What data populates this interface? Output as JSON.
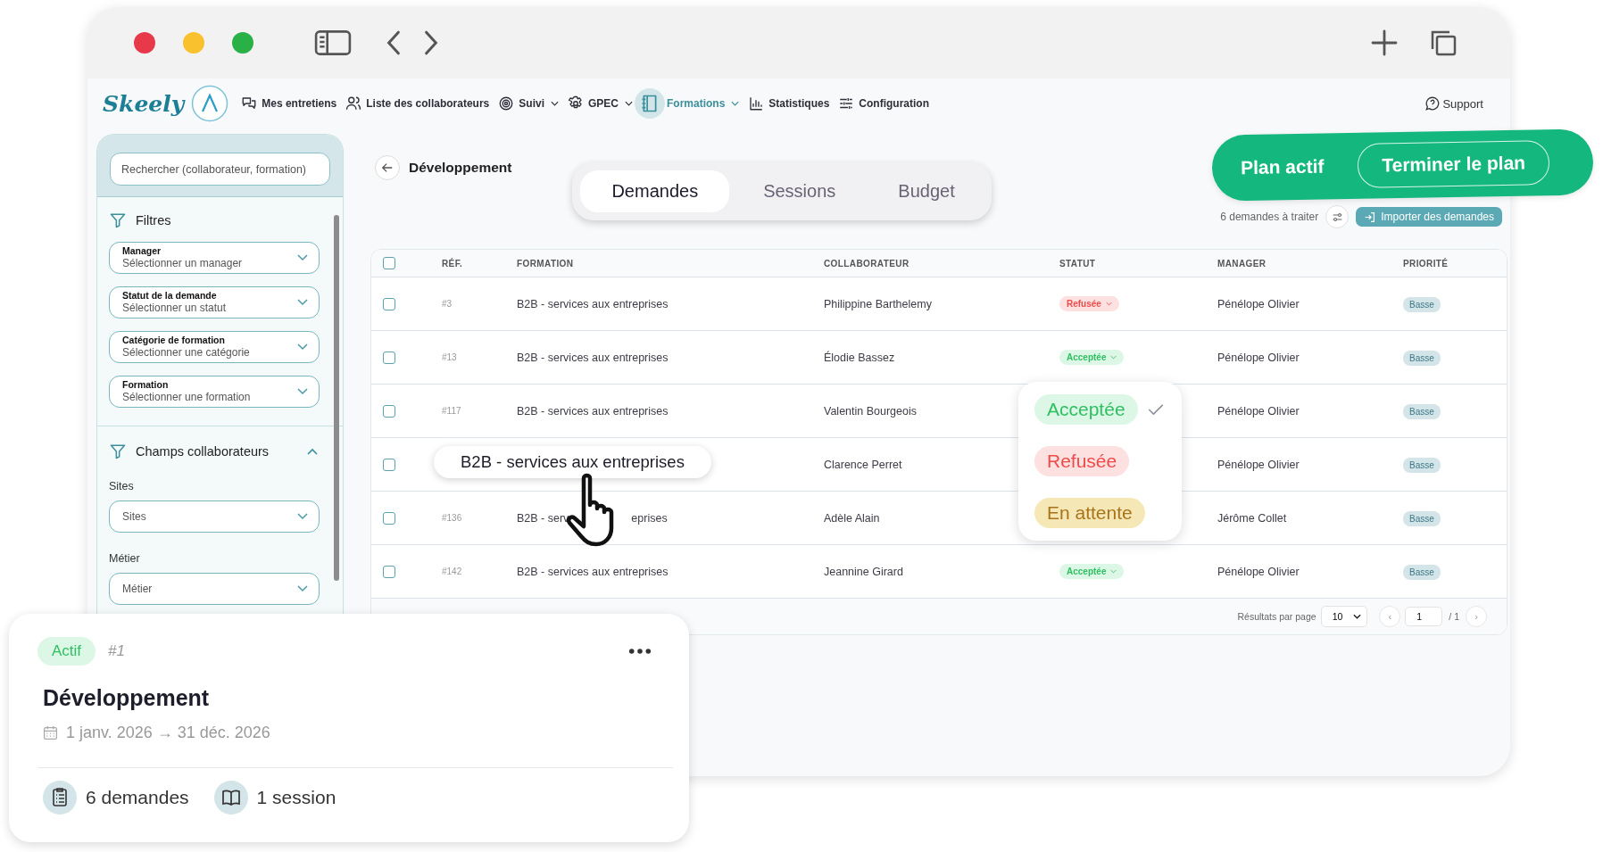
{
  "nav": {
    "logo": "Skeely",
    "items": [
      {
        "label": "Mes entretiens",
        "selected": false,
        "dropdown": false
      },
      {
        "label": "Liste des collaborateurs",
        "selected": false,
        "dropdown": false
      },
      {
        "label": "Suivi",
        "selected": false,
        "dropdown": true
      },
      {
        "label": "GPEC",
        "selected": false,
        "dropdown": true
      },
      {
        "label": "Formations",
        "selected": true,
        "dropdown": true
      },
      {
        "label": "Statistiques",
        "selected": false,
        "dropdown": false
      },
      {
        "label": "Configuration",
        "selected": false,
        "dropdown": false
      }
    ],
    "support": "Support"
  },
  "sidebar": {
    "search": {
      "placeholder": "Rechercher (collaborateur, formation)"
    },
    "filters_title": "Filtres",
    "filters": [
      {
        "label": "Manager",
        "placeholder": "Sélectionner un manager"
      },
      {
        "label": "Statut de la demande",
        "placeholder": "Sélectionner un statut"
      },
      {
        "label": "Catégorie de formation",
        "placeholder": "Sélectionner une catégorie"
      },
      {
        "label": "Formation",
        "placeholder": "Sélectionner une formation"
      }
    ],
    "section": {
      "title": "Champs collaborateurs",
      "expanded": true,
      "fields": [
        {
          "label": "Sites",
          "placeholder": "Sites"
        },
        {
          "label": "Métier",
          "placeholder": "Métier"
        }
      ]
    }
  },
  "header": {
    "title": "Développement",
    "tabs": [
      {
        "label": "Demandes",
        "selected": true
      },
      {
        "label": "Sessions",
        "selected": false
      },
      {
        "label": "Budget",
        "selected": false
      }
    ],
    "pending": "6 demandes à traiter",
    "import_button": "Importer des demandes"
  },
  "plan_banner": {
    "label": "Plan actif",
    "button": "Terminer le plan"
  },
  "table": {
    "select_all_checked": false,
    "columns": [
      "RÉF.",
      "FORMATION",
      "COLLABORATEUR",
      "STATUT",
      "MANAGER",
      "PRIORITÉ"
    ],
    "rows": [
      {
        "checked": false,
        "ref": "#3",
        "formation": "B2B - services aux entreprises",
        "collaborateur": "Philippine Barthelemy",
        "statut": {
          "label": "Refusée",
          "kind": "refused"
        },
        "manager": "Pénélope Olivier",
        "priorite": "Basse"
      },
      {
        "checked": false,
        "ref": "#13",
        "formation": "B2B - services aux entreprises",
        "collaborateur": "Élodie Bassez",
        "statut": {
          "label": "Acceptée",
          "kind": "accepted"
        },
        "manager": "Pénélope Olivier",
        "priorite": "Basse"
      },
      {
        "checked": false,
        "ref": "#117",
        "formation": "B2B - services aux entreprises",
        "collaborateur": "Valentin Bourgeois",
        "manager": "Pénélope Olivier",
        "priorite": "Basse"
      },
      {
        "checked": false,
        "collaborateur": "Clarence Perret",
        "manager": "Pénélope Olivier",
        "priorite": "Basse"
      },
      {
        "checked": false,
        "ref": "#136",
        "formation_parts": [
          "B2B - serv",
          "eprises"
        ],
        "collaborateur": "Adèle Alain",
        "manager": "Jérôme Collet",
        "priorite": "Basse"
      },
      {
        "checked": false,
        "ref": "#142",
        "formation": "B2B - services aux entreprises",
        "collaborateur": "Jeannine Girard",
        "statut": {
          "label": "Acceptée",
          "kind": "accepted"
        },
        "manager": "Pénélope Olivier",
        "priorite": "Basse"
      }
    ],
    "footer": {
      "per_page_label": "Résultats par page",
      "per_page": "10",
      "prev": "‹",
      "page": "1",
      "total": "/ 1",
      "next": "›"
    }
  },
  "tooltip": {
    "text": "B2B - services aux entreprises"
  },
  "status_menu": {
    "options": [
      {
        "label": "Acceptée",
        "kind": "accepted",
        "selected": true
      },
      {
        "label": "Refusée",
        "kind": "refused",
        "selected": false
      },
      {
        "label": "En attente",
        "kind": "pending",
        "selected": false
      }
    ]
  },
  "plan_card": {
    "badge": "Actif",
    "number": "#1",
    "title": "Développement",
    "dates": "1 janv. 2026 → 31 déc. 2026",
    "stats": [
      {
        "label": "6 demandes"
      },
      {
        "label": "1 session"
      }
    ]
  }
}
